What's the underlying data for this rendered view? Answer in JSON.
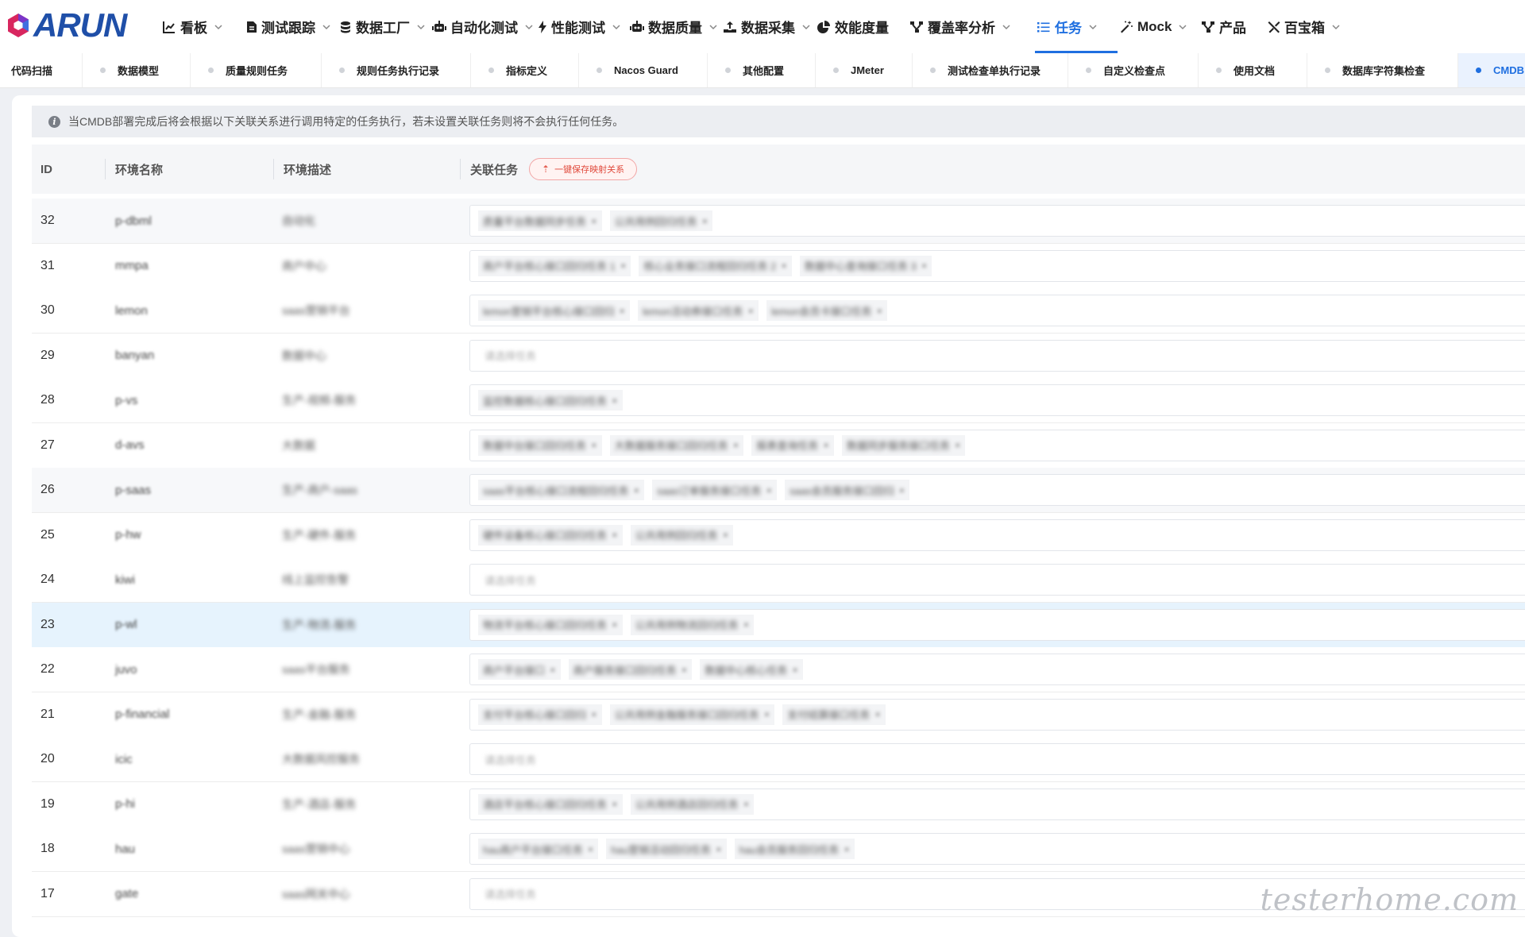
{
  "brand": {
    "logo_text": "ARUN",
    "accent": "#1f6fe0"
  },
  "nav": [
    {
      "label": "看板",
      "icon": "chart-line-icon",
      "has_menu": true
    },
    {
      "label": "测试跟踪",
      "icon": "document-icon",
      "has_menu": true
    },
    {
      "label": "数据工厂",
      "icon": "database-icon",
      "has_menu": true
    },
    {
      "label": "自动化测试",
      "icon": "robot-icon",
      "has_menu": true
    },
    {
      "label": "性能测试",
      "icon": "bolt-icon",
      "has_menu": true
    },
    {
      "label": "数据质量",
      "icon": "robot-icon",
      "has_menu": true
    },
    {
      "label": "数据采集",
      "icon": "upload-icon",
      "has_menu": true
    },
    {
      "label": "效能度量",
      "icon": "pie-chart-icon",
      "has_menu": false
    },
    {
      "label": "覆盖率分析",
      "icon": "branch-icon",
      "has_menu": true
    },
    {
      "label": "任务",
      "icon": "list-icon",
      "has_menu": true,
      "active": true
    },
    {
      "label": "Mock",
      "icon": "magic-wand-icon",
      "has_menu": true
    },
    {
      "label": "产品",
      "icon": "branch-icon",
      "has_menu": false
    },
    {
      "label": "百宝箱",
      "icon": "tools-icon",
      "has_menu": true
    }
  ],
  "tabs": [
    {
      "label": "代码扫描"
    },
    {
      "label": "数据模型"
    },
    {
      "label": "质量规则任务"
    },
    {
      "label": "规则任务执行记录"
    },
    {
      "label": "指标定义"
    },
    {
      "label": "Nacos Guard"
    },
    {
      "label": "其他配置"
    },
    {
      "label": "JMeter"
    },
    {
      "label": "测试检查单执行记录"
    },
    {
      "label": "自定义检查点"
    },
    {
      "label": "使用文档"
    },
    {
      "label": "数据库字符集检查"
    },
    {
      "label": "CMDB",
      "active": true
    }
  ],
  "notice": "当CMDB部署完成后将会根据以下关联关系进行调用特定的任务执行，若未设置关联任务则将不会执行任何任务。",
  "table": {
    "columns": {
      "id": "ID",
      "name": "环境名称",
      "desc": "环境描述",
      "tasks": "关联任务"
    },
    "save_button": "一键保存映射关系",
    "rows": [
      {
        "id": "32",
        "name": "p-dbml",
        "desc": "自动化",
        "tasks": [
          "质量平台数据同步任务",
          "公共用例回归任务"
        ]
      },
      {
        "id": "31",
        "name": "mmpa",
        "desc": "商户中心",
        "tasks": [
          "商户平台核心接口回归任务 1",
          "核心业务接口流程回归任务 2",
          "数据中心查询接口任务 3"
        ]
      },
      {
        "id": "30",
        "name": "lemon",
        "desc": "saas营销平台",
        "tasks": [
          "lemon营销平台核心接口回归",
          "lemon活动券接口任务",
          "lemon会员卡接口任务"
        ]
      },
      {
        "id": "29",
        "name": "banyan",
        "desc": "数据中心",
        "tasks": []
      },
      {
        "id": "28",
        "name": "p-vs",
        "desc": "生产-视频-服务",
        "tasks": [
          "监控数据核心接口回归任务"
        ]
      },
      {
        "id": "27",
        "name": "d-avs",
        "desc": "大数据",
        "tasks": [
          "数据中台接口回归任务",
          "大数据服务接口回归任务",
          "报表查询任务",
          "数据同步服务接口任务"
        ]
      },
      {
        "id": "26",
        "name": "p-saas",
        "desc": "生产-商户-saas",
        "tasks": [
          "saas平台核心接口流程回归任务",
          "saas订单服务接口任务",
          "saas会员服务接口回归"
        ]
      },
      {
        "id": "25",
        "name": "p-hw",
        "desc": "生产-硬件-服务",
        "tasks": [
          "硬件设备核心接口回归任务",
          "公共用例回归任务"
        ]
      },
      {
        "id": "24",
        "name": "kiwi",
        "desc": "线上监控告警",
        "tasks": []
      },
      {
        "id": "23",
        "name": "p-wl",
        "desc": "生产-物流-服务",
        "tasks": [
          "物流平台核心接口回归任务",
          "公共用例物流回归任务"
        ]
      },
      {
        "id": "22",
        "name": "juvo",
        "desc": "saas平台服务",
        "tasks": [
          "商户平台接口",
          "商户服务接口回归任务",
          "数据中心核心任务"
        ]
      },
      {
        "id": "21",
        "name": "p-financial",
        "desc": "生产-金融-服务",
        "tasks": [
          "支付平台核心接口回归",
          "公共用例金融服务接口回归任务",
          "支付结算接口任务"
        ]
      },
      {
        "id": "20",
        "name": "icic",
        "desc": "大数据风控服务",
        "tasks": []
      },
      {
        "id": "19",
        "name": "p-hi",
        "desc": "生产-酒店-服务",
        "tasks": [
          "酒店平台核心接口回归任务",
          "公共用例酒店回归任务"
        ]
      },
      {
        "id": "18",
        "name": "hau",
        "desc": "saas营销中心",
        "tasks": [
          "hau商户平台接口任务",
          "hau营销活动回归任务",
          "hau会员服务回归任务"
        ]
      },
      {
        "id": "17",
        "name": "gate",
        "desc": "saas网关中心",
        "tasks": []
      }
    ],
    "empty_placeholder": "请选择任务"
  },
  "watermark": "testerhome.com"
}
